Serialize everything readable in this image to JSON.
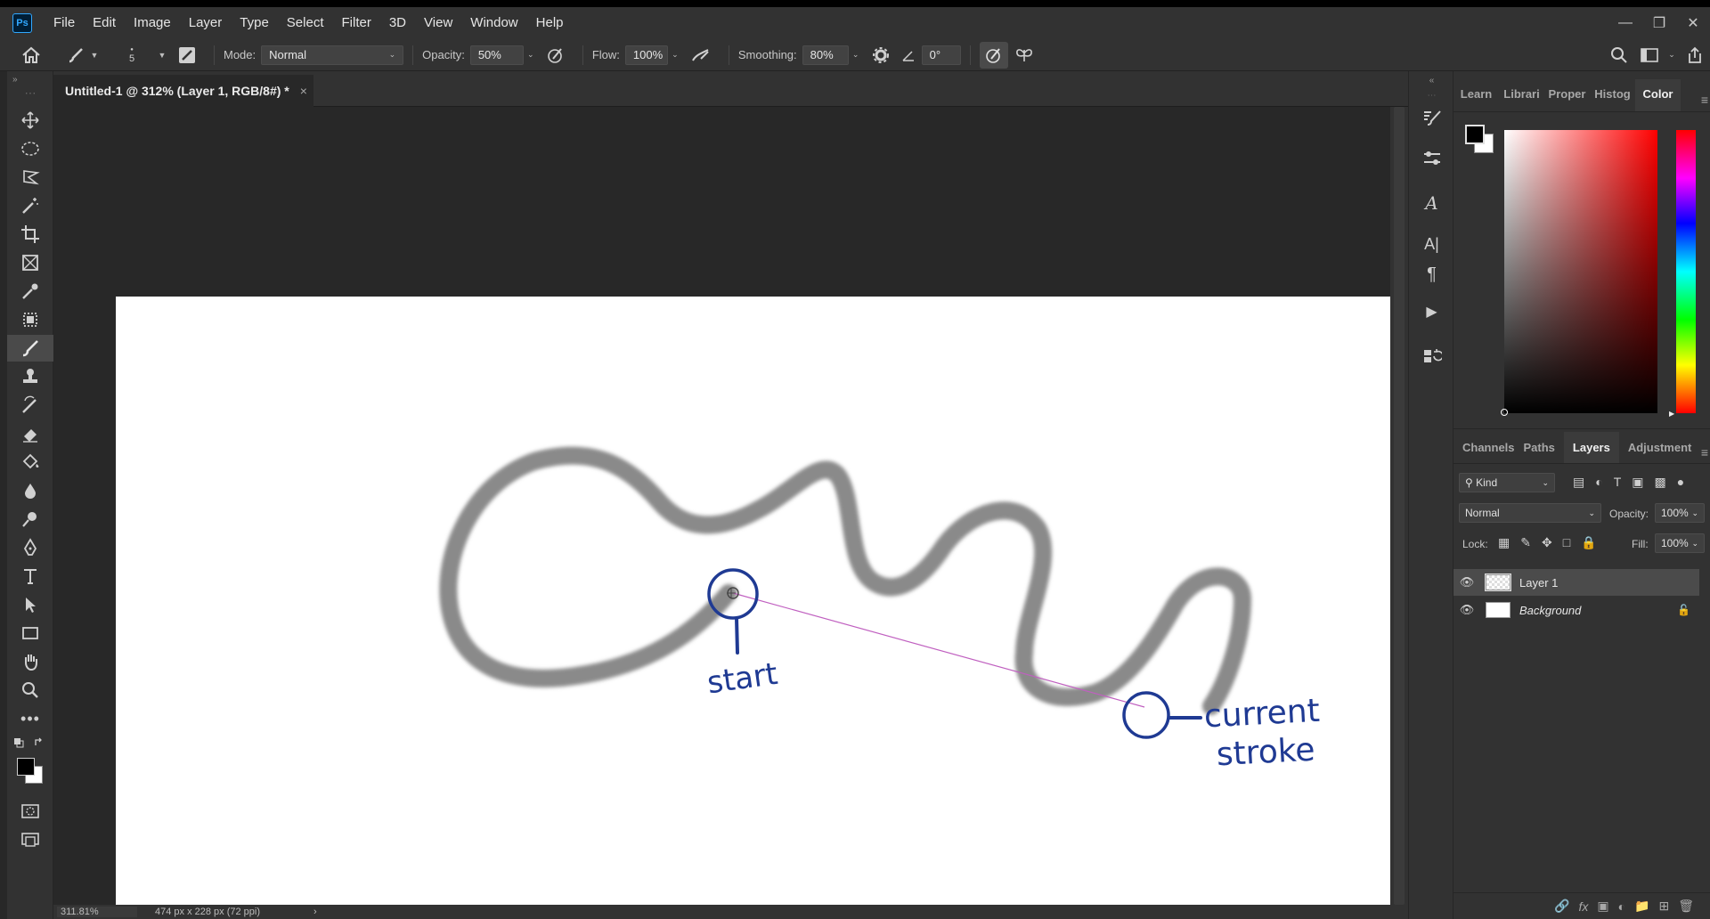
{
  "menu": {
    "items": [
      "File",
      "Edit",
      "Image",
      "Layer",
      "Type",
      "Select",
      "Filter",
      "3D",
      "View",
      "Window",
      "Help"
    ],
    "logo_text": "Ps"
  },
  "options": {
    "brush_size": "5",
    "mode_label": "Mode:",
    "mode_value": "Normal",
    "opacity_label": "Opacity:",
    "opacity_value": "50%",
    "flow_label": "Flow:",
    "flow_value": "100%",
    "smoothing_label": "Smoothing:",
    "smoothing_value": "80%",
    "angle_value": "0°"
  },
  "document": {
    "tab_title": "Untitled-1 @ 312% (Layer 1, RGB/8#) *",
    "close_glyph": "×",
    "annotations": {
      "start": "start",
      "current_1": "current",
      "current_2": "stroke"
    }
  },
  "status": {
    "zoom": "311.81%",
    "doc_info": "474 px x 228 px (72 ppi)"
  },
  "panels": {
    "top_tabs": [
      "Learn",
      "Librari",
      "Proper",
      "Histog",
      "Color"
    ],
    "layer_tabs": [
      "Channels",
      "Paths",
      "Layers",
      "Adjustment"
    ],
    "kind_label": "Kind",
    "blend_mode": "Normal",
    "opacity_label": "Opacity:",
    "opacity_value": "100%",
    "lock_label": "Lock:",
    "fill_label": "Fill:",
    "fill_value": "100%",
    "layers": [
      {
        "name": "Layer 1"
      },
      {
        "name": "Background"
      }
    ]
  },
  "colors": {
    "foreground": "#000000",
    "background": "#ffffff",
    "annotation_ink": "#1f3a93",
    "stroke_gray": "#8a8a8a",
    "guide_line": "#c060c0"
  }
}
